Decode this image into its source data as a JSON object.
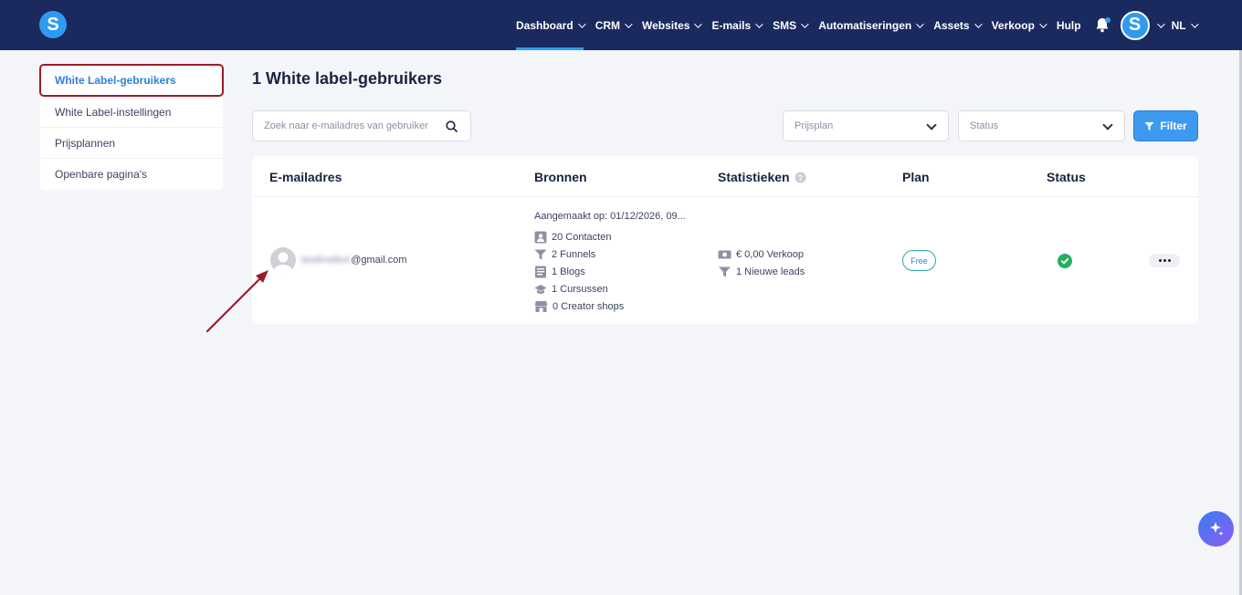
{
  "brand": {
    "logo_letter": "S",
    "accent": "#2f9bf0",
    "nav_bg": "#1b2a5e"
  },
  "nav": {
    "items": [
      {
        "label": "Dashboard",
        "active": true
      },
      {
        "label": "CRM"
      },
      {
        "label": "Websites"
      },
      {
        "label": "E-mails"
      },
      {
        "label": "SMS"
      },
      {
        "label": "Automatiseringen"
      },
      {
        "label": "Assets"
      },
      {
        "label": "Verkoop"
      }
    ],
    "help": "Hulp",
    "bell_icon": "bell-icon",
    "avatar_letter": "S",
    "language": "NL"
  },
  "sidebar": {
    "items": [
      {
        "label": "White Label-gebruikers",
        "active": true
      },
      {
        "label": "White Label-instellingen"
      },
      {
        "label": "Prijsplannen"
      },
      {
        "label": "Openbare pagina's"
      }
    ]
  },
  "main": {
    "title": "1 White label-gebruikers",
    "search_placeholder": "Zoek naar e-mailadres van gebruiker",
    "plan_select": "Prijsplan",
    "status_select": "Status",
    "filter_label": "Filter"
  },
  "table": {
    "headers": {
      "email": "E-mailadres",
      "sources": "Bronnen",
      "stats": "Statistieken",
      "plan": "Plan",
      "status": "Status"
    },
    "rows": [
      {
        "email_hidden": "testlinetbot",
        "email_domain": "@gmail.com",
        "created": "Aangemaakt op: 01/12/2026, 09...",
        "sources": [
          {
            "icon": "contact-icon",
            "text": "20 Contacten"
          },
          {
            "icon": "funnel-icon",
            "text": "2 Funnels"
          },
          {
            "icon": "blog-icon",
            "text": "1 Blogs"
          },
          {
            "icon": "graduation-cap-icon",
            "text": "1 Cursussen"
          },
          {
            "icon": "shop-icon",
            "text": "0 Creator shops"
          }
        ],
        "stats": [
          {
            "icon": "money-icon",
            "text": "€ 0,00 Verkoop"
          },
          {
            "icon": "funnel-icon",
            "text": "1 Nieuwe leads"
          }
        ],
        "plan": "Free",
        "status": "active"
      }
    ]
  }
}
